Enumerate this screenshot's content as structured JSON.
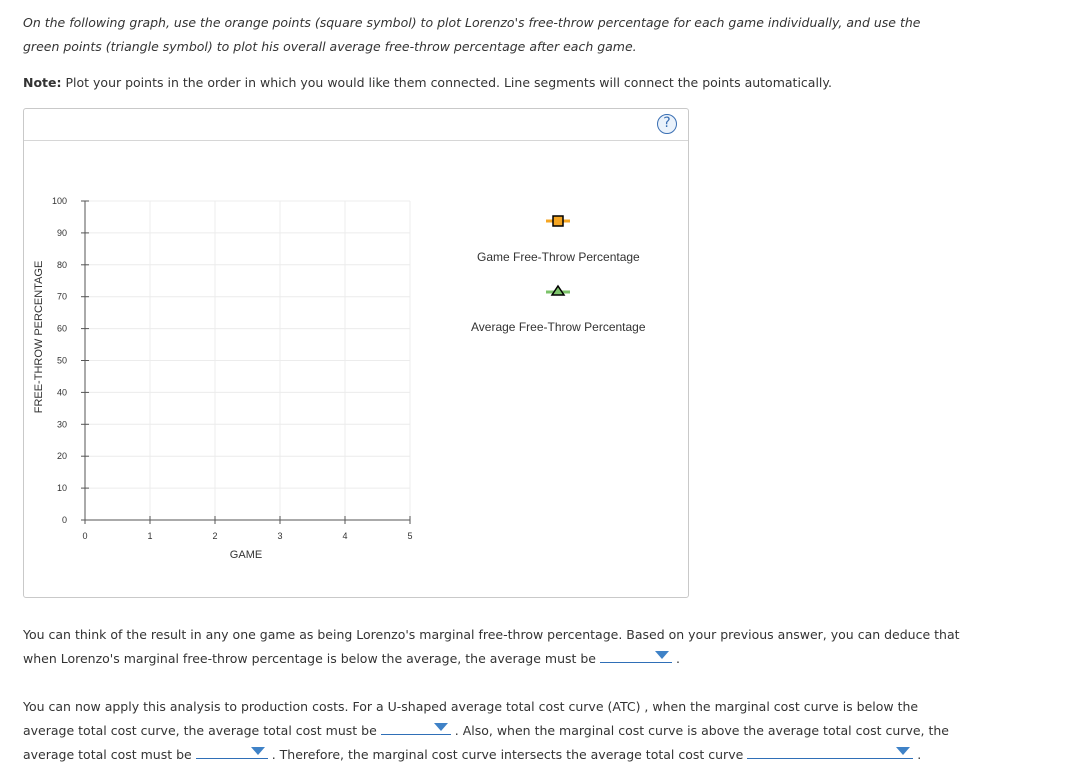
{
  "instructions": {
    "intro": "On the following graph, use the orange points (square symbol) to plot Lorenzo's free-throw percentage for each game individually, and use the green points (triangle symbol) to plot his overall average free-throw percentage after each game.",
    "note_label": "Note:",
    "note_text": " Plot your points in the order in which you would like them connected. Line segments will connect the points automatically."
  },
  "graph": {
    "help_symbol": "?",
    "legend": {
      "game_label": "Game Free-Throw Percentage",
      "average_label": "Average Free-Throw Percentage",
      "game_color": "#f5a623",
      "average_color": "#7cc36a"
    }
  },
  "chart_data": {
    "type": "line",
    "xlabel": "GAME",
    "ylabel": "FREE-THROW PERCENTAGE",
    "xlim": [
      0,
      5
    ],
    "ylim": [
      0,
      100
    ],
    "x_ticks": [
      "0",
      "1",
      "2",
      "3",
      "4",
      "5"
    ],
    "y_ticks": [
      "0",
      "10",
      "20",
      "30",
      "40",
      "50",
      "60",
      "70",
      "80",
      "90",
      "100"
    ],
    "grid": true,
    "series": [
      {
        "name": "Game Free-Throw Percentage",
        "marker": "square",
        "color": "#f5a623",
        "points": []
      },
      {
        "name": "Average Free-Throw Percentage",
        "marker": "triangle",
        "color": "#7cc36a",
        "points": []
      }
    ]
  },
  "question1": {
    "text_a": "You can think of the result in any one game as being Lorenzo's marginal free-throw percentage. Based on your previous answer, you can deduce that when Lorenzo's marginal free-throw percentage is below the average, the average must be",
    "text_b": " .",
    "selected": ""
  },
  "question2": {
    "text_a": "You can now apply this analysis to production costs. For a U-shaped average total cost curve (ATC) , when the marginal cost curve is below the average total cost curve, the average total cost must be",
    "text_b": " . Also, when the marginal cost curve is above the average total cost curve, the average total cost must be",
    "text_c": " . Therefore, the marginal cost curve intersects the average total cost curve",
    "text_d": " .",
    "selected_1": "",
    "selected_2": "",
    "selected_3": ""
  }
}
